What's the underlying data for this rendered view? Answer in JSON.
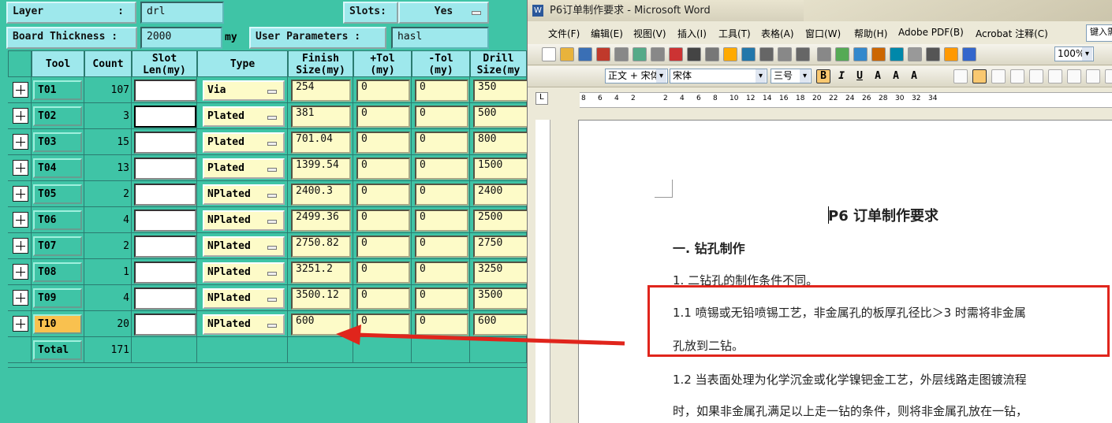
{
  "cam": {
    "layer_label": "Layer",
    "layer_colon": ":",
    "layer_value": "drl",
    "slots_label": "Slots:",
    "slots_value": "Yes",
    "board_thickness_label": "Board Thickness :",
    "board_thickness_value": "2000",
    "board_thickness_unit": "my",
    "user_params_label": "User Parameters :",
    "user_params_value": "hasl",
    "headers": [
      "Tool",
      "Count",
      "Slot\nLen(my)",
      "Type",
      "Finish\nSize(my)",
      "+Tol\n(my)",
      "-Tol\n(my)",
      "Drill\nSize(my"
    ],
    "rows": [
      {
        "tool": "T01",
        "count": "107",
        "type": "Via",
        "finish": "254",
        "ptol": "0",
        "ntol": "0",
        "drill": "350"
      },
      {
        "tool": "T02",
        "count": "3",
        "type": "Plated",
        "finish": "381",
        "ptol": "0",
        "ntol": "0",
        "drill": "500"
      },
      {
        "tool": "T03",
        "count": "15",
        "type": "Plated",
        "finish": "701.04",
        "ptol": "0",
        "ntol": "0",
        "drill": "800"
      },
      {
        "tool": "T04",
        "count": "13",
        "type": "Plated",
        "finish": "1399.54",
        "ptol": "0",
        "ntol": "0",
        "drill": "1500"
      },
      {
        "tool": "T05",
        "count": "2",
        "type": "NPlated",
        "finish": "2400.3",
        "ptol": "0",
        "ntol": "0",
        "drill": "2400"
      },
      {
        "tool": "T06",
        "count": "4",
        "type": "NPlated",
        "finish": "2499.36",
        "ptol": "0",
        "ntol": "0",
        "drill": "2500"
      },
      {
        "tool": "T07",
        "count": "2",
        "type": "NPlated",
        "finish": "2750.82",
        "ptol": "0",
        "ntol": "0",
        "drill": "2750"
      },
      {
        "tool": "T08",
        "count": "1",
        "type": "NPlated",
        "finish": "3251.2",
        "ptol": "0",
        "ntol": "0",
        "drill": "3250"
      },
      {
        "tool": "T09",
        "count": "4",
        "type": "NPlated",
        "finish": "3500.12",
        "ptol": "0",
        "ntol": "0",
        "drill": "3500"
      },
      {
        "tool": "T10",
        "count": "20",
        "type": "NPlated",
        "finish": "600",
        "ptol": "0",
        "ntol": "0",
        "drill": "600"
      }
    ],
    "total_label": "Total",
    "total_count": "171"
  },
  "word": {
    "title": "P6订单制作要求 - Microsoft Word",
    "menus": [
      "文件(F)",
      "编辑(E)",
      "视图(V)",
      "插入(I)",
      "工具(T)",
      "表格(A)",
      "窗口(W)",
      "帮助(H)",
      "Adobe PDF(B)",
      "Acrobat 注释(C)"
    ],
    "help_box": "键入需",
    "zoom": "100%",
    "style": "正文 + 宋体",
    "font": "宋体",
    "size": "三号",
    "ruler_nums": [
      "8",
      "6",
      "4",
      "2",
      "2",
      "4",
      "6",
      "8",
      "10",
      "12",
      "14",
      "16",
      "18",
      "20",
      "22",
      "24",
      "26",
      "28",
      "30",
      "32",
      "34"
    ],
    "doc_title": "P6 订单制作要求",
    "heading1": "一. 钻孔制作",
    "p1": "1. 二钻孔的制作条件不同。",
    "p11a": "1.1  喷锡或无铅喷锡工艺，非金属孔的板厚孔径比＞3 时需将非金属",
    "p11b": "孔放到二钻。",
    "p12a": "1.2  当表面处理为化学沉金或化学镍钯金工艺，外层线路走图镀流程",
    "p12b": "时，如果非金属孔满足以上走一钻的条件，则将非金属孔放在一钻，"
  },
  "colors": {
    "panel": "#3fc4a6",
    "label": "#9ee8ec",
    "selected_tool": "#f9c14f",
    "field": "#fdfbc8",
    "annotation": "#e0251c"
  }
}
